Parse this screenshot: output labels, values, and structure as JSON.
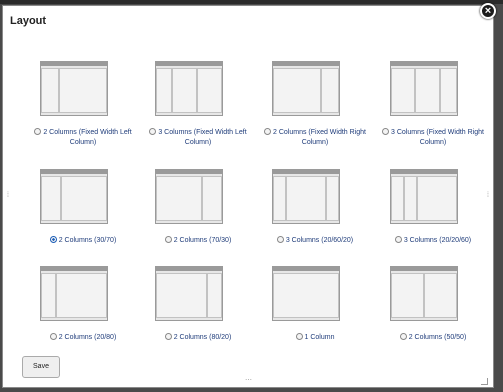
{
  "dialog": {
    "title": "Layout",
    "close_icon": "close-x-icon",
    "save_label": "Save"
  },
  "options": [
    {
      "label": "2 Columns (Fixed Width Left Column)",
      "selected": false
    },
    {
      "label": "3 Columns (Fixed Width Left Column)",
      "selected": false
    },
    {
      "label": "2 Columns (Fixed Width Right Column)",
      "selected": false
    },
    {
      "label": "3 Columns (Fixed Width Right Column)",
      "selected": false
    },
    {
      "label": "2 Columns (30/70)",
      "selected": true
    },
    {
      "label": "2 Columns (70/30)",
      "selected": false
    },
    {
      "label": "3 Columns (20/60/20)",
      "selected": false
    },
    {
      "label": "3 Columns (20/20/60)",
      "selected": false
    },
    {
      "label": "2 Columns (20/80)",
      "selected": false
    },
    {
      "label": "2 Columns (80/20)",
      "selected": false
    },
    {
      "label": "1 Column",
      "selected": false
    },
    {
      "label": "2 Columns (50/50)",
      "selected": false
    }
  ]
}
